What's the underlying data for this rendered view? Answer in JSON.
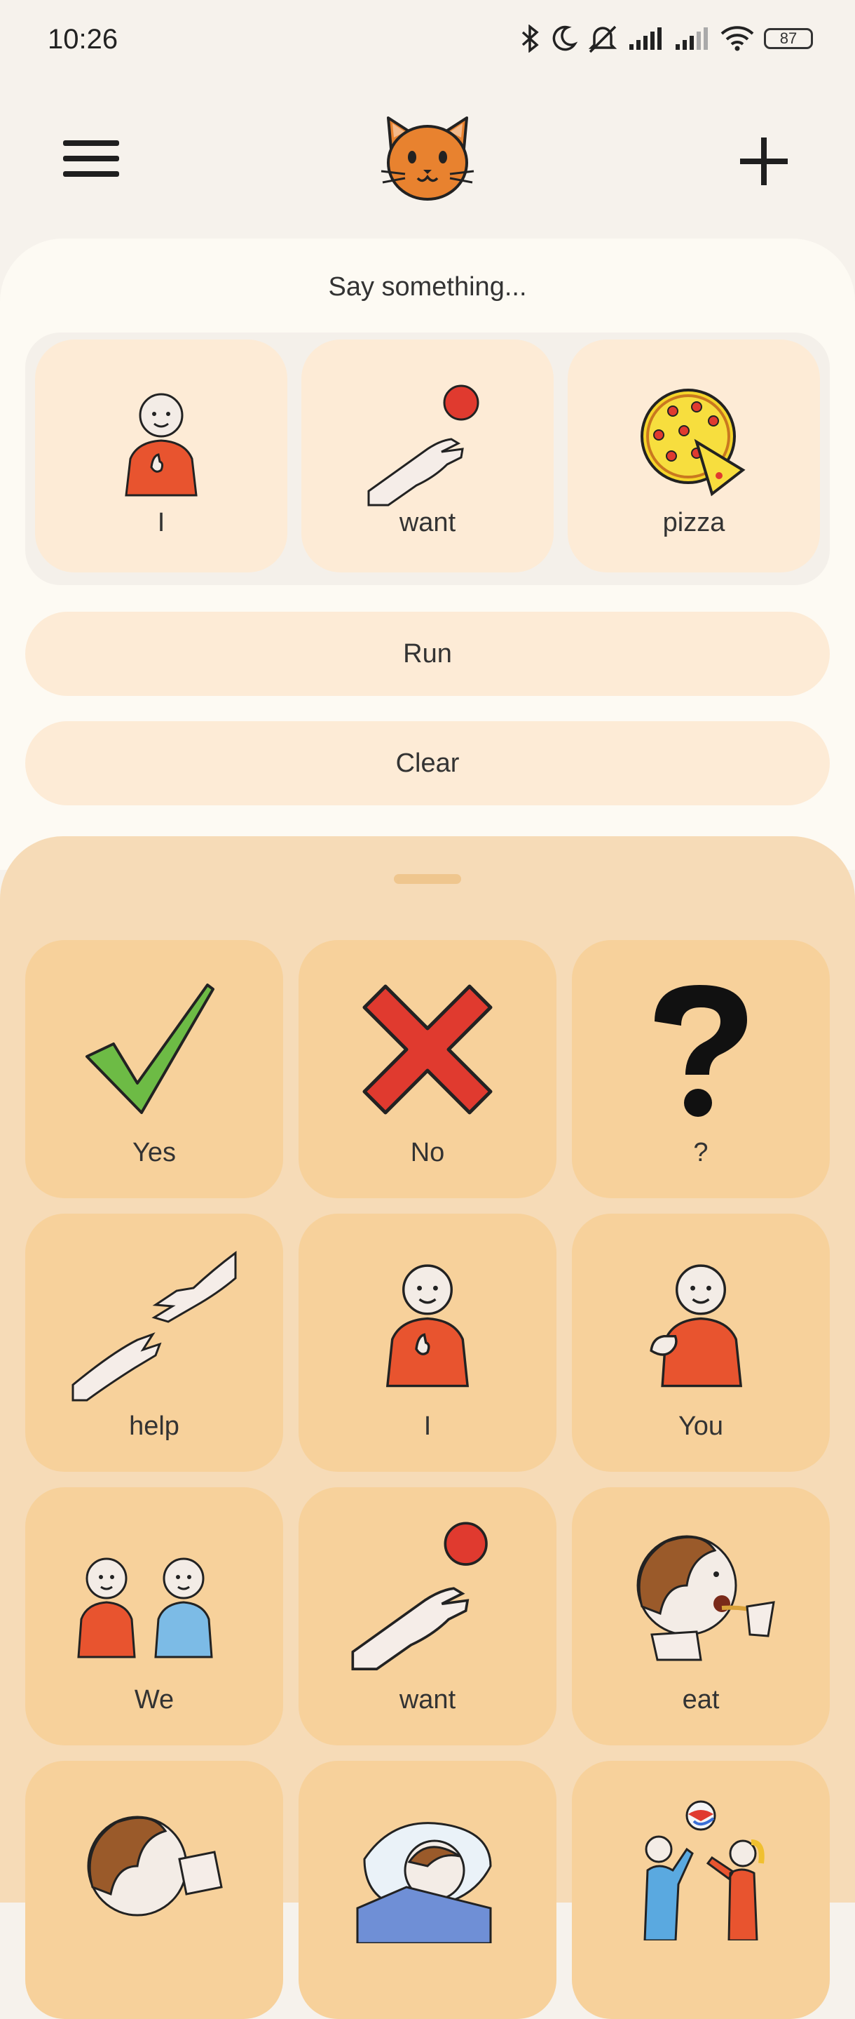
{
  "status_bar": {
    "time": "10:26",
    "battery": "87",
    "icons": [
      "bluetooth-icon",
      "moon-icon",
      "bell-off-icon",
      "signal-icon",
      "signal-icon",
      "wifi-icon",
      "battery-icon"
    ]
  },
  "app_bar": {
    "menu_icon": "menu-icon",
    "logo_icon": "cat-face-icon",
    "add_icon": "plus-icon"
  },
  "sentence": {
    "prompt": "Say something...",
    "words": [
      {
        "label": "I",
        "icon": "person-self-icon"
      },
      {
        "label": "want",
        "icon": "hand-reach-icon"
      },
      {
        "label": "pizza",
        "icon": "pizza-icon"
      }
    ],
    "run_label": "Run",
    "clear_label": "Clear"
  },
  "board": {
    "tiles": [
      {
        "label": "Yes",
        "icon": "check-icon"
      },
      {
        "label": "No",
        "icon": "cross-icon"
      },
      {
        "label": "?",
        "icon": "question-icon"
      },
      {
        "label": "help",
        "icon": "help-hands-icon"
      },
      {
        "label": "I",
        "icon": "person-self-icon"
      },
      {
        "label": "You",
        "icon": "person-point-icon"
      },
      {
        "label": "We",
        "icon": "two-people-icon"
      },
      {
        "label": "want",
        "icon": "hand-reach-icon"
      },
      {
        "label": "eat",
        "icon": "eat-icon"
      },
      {
        "label": "",
        "icon": "drink-icon"
      },
      {
        "label": "",
        "icon": "sleep-icon"
      },
      {
        "label": "",
        "icon": "play-icon"
      }
    ]
  },
  "colors": {
    "background": "#f6f2ec",
    "sentence_panel": "#fdfaf3",
    "word_card": "#fdebd6",
    "board": "#f6dbb7",
    "tile": "#f7d19b"
  }
}
